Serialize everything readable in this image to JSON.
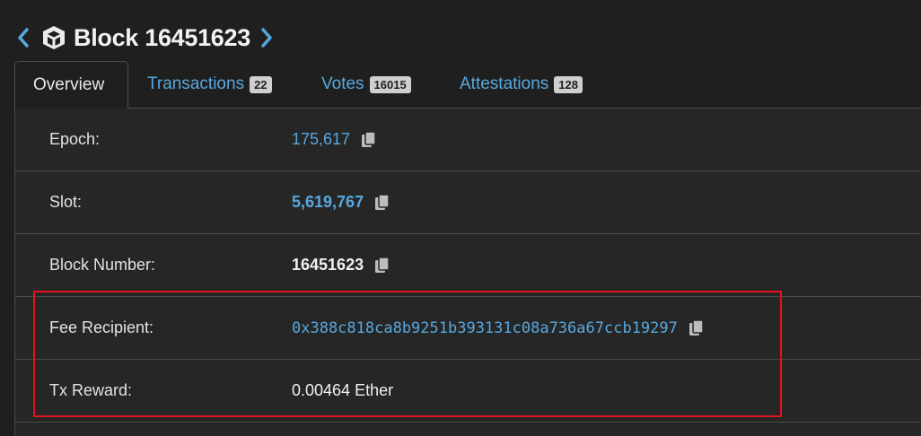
{
  "header": {
    "title": "Block 16451623",
    "prev_icon": "chevron-left-icon",
    "next_icon": "chevron-right-icon",
    "block_icon": "cube-icon",
    "accent_color": "#58a8de"
  },
  "tabs": [
    {
      "label": "Overview",
      "badge": ""
    },
    {
      "label": "Transactions",
      "badge": "22"
    },
    {
      "label": "Votes",
      "badge": "16015"
    },
    {
      "label": "Attestations",
      "badge": "128"
    }
  ],
  "rows": [
    {
      "label": "Epoch:",
      "value": "175,617"
    },
    {
      "label": "Slot:",
      "value": "5,619,767"
    },
    {
      "label": "Block Number:",
      "value": "16451623"
    },
    {
      "label": "Fee Recipient:",
      "value": "0x388c818ca8b9251b393131c08a736a67ccb19297"
    },
    {
      "label": "Tx Reward:",
      "value": "0.00464 Ether"
    }
  ],
  "copy_icon": "copy-icon",
  "highlight_color": "#e0141e"
}
